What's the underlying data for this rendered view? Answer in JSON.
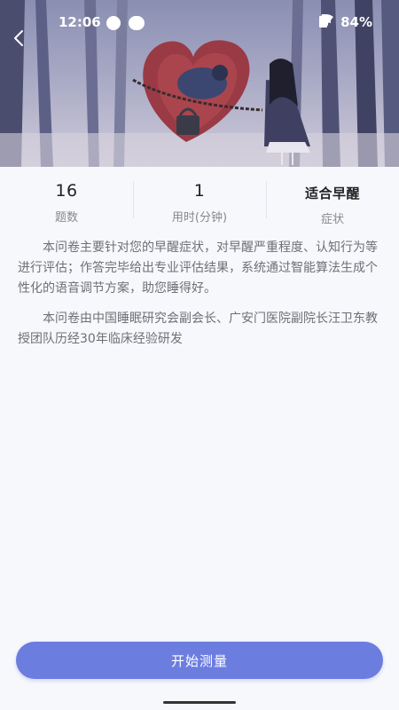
{
  "status_bar": {
    "time": "12:06",
    "battery": "84%"
  },
  "header": {
    "back_icon": "chevron-left-icon",
    "illustration": "girl-and-heart-illustration"
  },
  "stats": [
    {
      "value": "16",
      "label": "题数"
    },
    {
      "value": "1",
      "label": "用时(分钟)"
    },
    {
      "value": "适合早醒",
      "label": "症状"
    }
  ],
  "description": {
    "paragraph1": "本问卷主要针对您的早醒症状，对早醒严重程度、认知行为等进行评估；作答完毕给出专业评估结果，系统通过智能算法生成个性化的语音调节方案，助您睡得好。",
    "paragraph2": "本问卷由中国睡眠研究会副会长、广安门医院副院长汪卫东教授团队历经30年临床经验研发"
  },
  "actions": {
    "start_label": "开始测量"
  },
  "colors": {
    "accent": "#6c7de0",
    "background": "#f7f8fc"
  }
}
